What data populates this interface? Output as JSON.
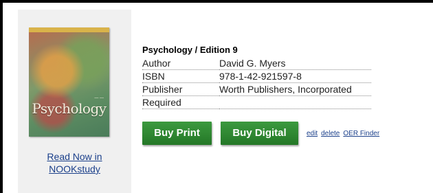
{
  "cover": {
    "title": "Psychology",
    "read_link_line1": "Read Now in",
    "read_link_line2": "NOOKstudy"
  },
  "book": {
    "title": "Psychology",
    "separator": "/",
    "edition": "Edition 9",
    "rows": [
      {
        "label": "Author",
        "value": "David G. Myers"
      },
      {
        "label": "ISBN",
        "value": "978-1-42-921597-8"
      },
      {
        "label": "Publisher",
        "value": "Worth Publishers, Incorporated"
      },
      {
        "label": "Required",
        "value": ""
      }
    ]
  },
  "actions": {
    "buy_print": "Buy Print",
    "buy_digital": "Buy Digital",
    "edit": "edit",
    "delete": "delete",
    "oer_finder": "OER Finder"
  },
  "colors": {
    "button_green": "#2e8a32",
    "link_blue": "#1a3f8a",
    "panel_gray": "#f0f0f0"
  }
}
